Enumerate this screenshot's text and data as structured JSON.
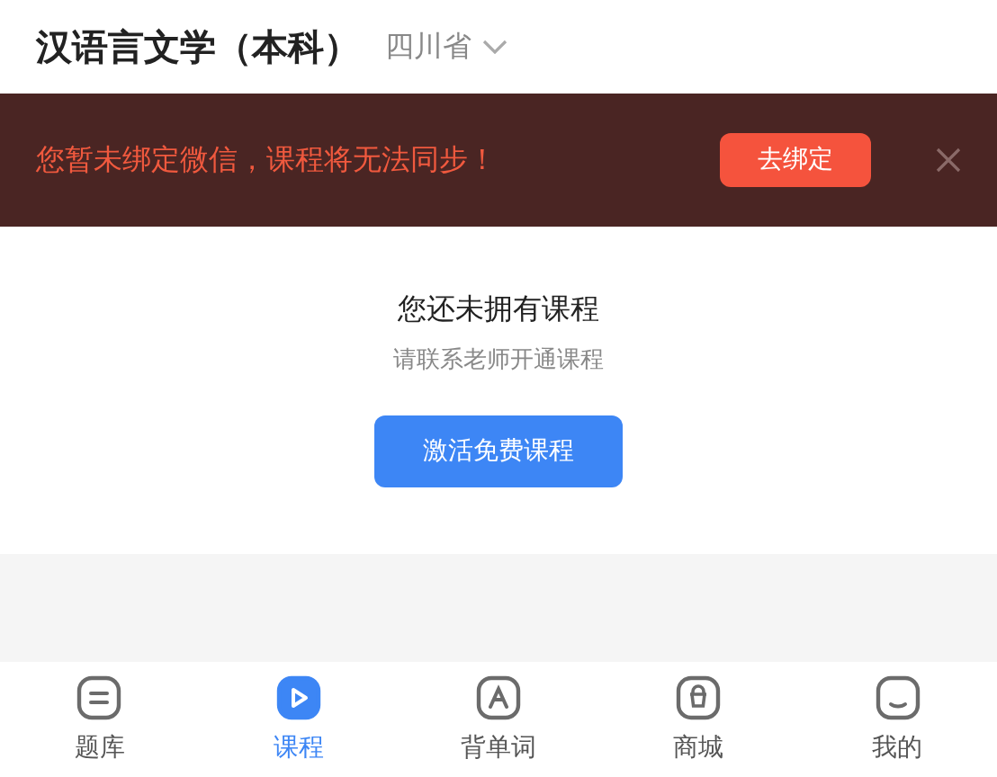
{
  "header": {
    "title": "汉语言文学（本科）",
    "province": "四川省"
  },
  "banner": {
    "message": "您暂未绑定微信，课程将无法同步！",
    "button": "去绑定"
  },
  "empty_state": {
    "title": "您还未拥有课程",
    "subtitle": "请联系老师开通课程",
    "button": "激活免费课程"
  },
  "tabs": [
    {
      "kind": "list",
      "label": "题库",
      "selected": false
    },
    {
      "kind": "play",
      "label": "课程",
      "selected": true
    },
    {
      "kind": "letter",
      "label": "背单词",
      "selected": false
    },
    {
      "kind": "shop",
      "label": "商城",
      "selected": false
    },
    {
      "kind": "person",
      "label": "我的",
      "selected": false
    }
  ]
}
